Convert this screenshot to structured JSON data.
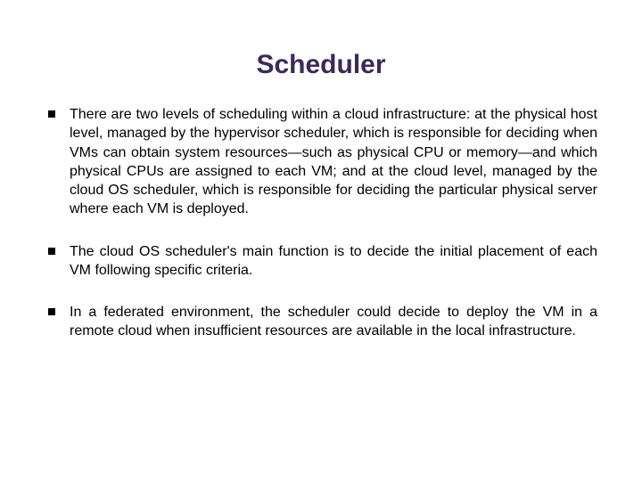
{
  "title": "Scheduler",
  "bullets": [
    "There are two levels of scheduling within a cloud infrastructure: at the physical host level, managed by the hypervisor scheduler, which is responsible for deciding when VMs can obtain system resources—such as physical CPU or memory—and which physical CPUs are assigned to each VM; and at the cloud level, managed by the cloud OS scheduler, which is responsible for deciding the particular physical server where each VM is deployed.",
    "The cloud OS scheduler's main function is to decide the initial placement of each VM following specific criteria.",
    "In a federated environment, the scheduler could decide to deploy the VM in a remote cloud when insufficient resources are available in the local infrastructure."
  ]
}
